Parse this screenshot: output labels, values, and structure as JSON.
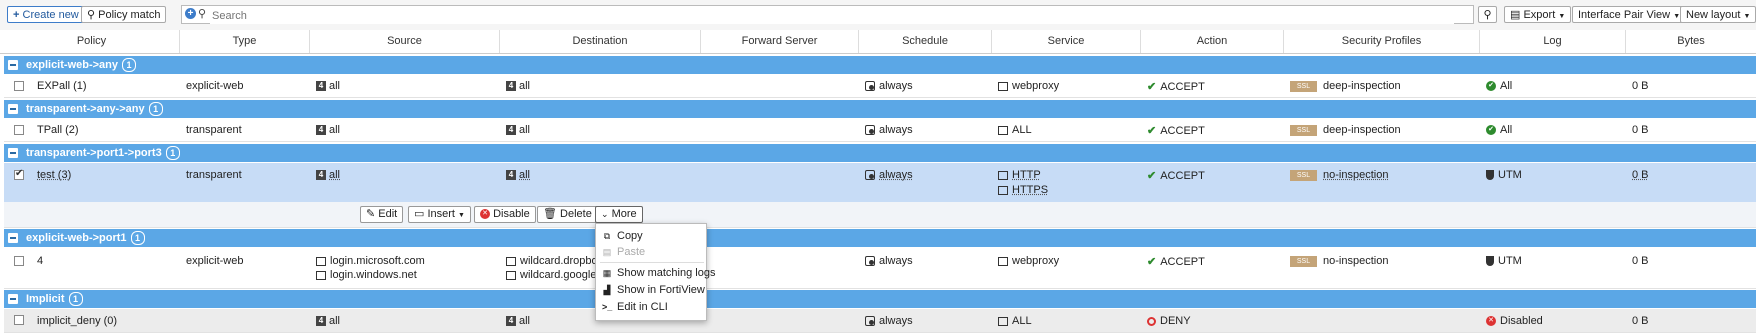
{
  "toolbar": {
    "create_new": "Create new",
    "policy_match": "Policy match",
    "search_placeholder": "Search",
    "export": "Export",
    "view": "Interface Pair View",
    "new_layout": "New layout"
  },
  "columns": [
    "Policy",
    "Type",
    "Source",
    "Destination",
    "Forward Server",
    "Schedule",
    "Service",
    "Action",
    "Security Profiles",
    "Log",
    "Bytes"
  ],
  "groups": [
    {
      "label": "explicit-web->any",
      "count": "1"
    },
    {
      "label": "transparent->any->any",
      "count": "1"
    },
    {
      "label": "transparent->port1->port3",
      "count": "1"
    },
    {
      "label": "explicit-web->port1",
      "count": "1"
    },
    {
      "label": "Implicit",
      "count": "1"
    }
  ],
  "rows": [
    {
      "policy": "EXPall (1)",
      "type": "explicit-web",
      "source": "all",
      "destination": "all",
      "schedule": "always",
      "service": "webproxy",
      "action": "ACCEPT",
      "ssl": "SSL",
      "profile": "deep-inspection",
      "log": "All",
      "bytes": "0 B"
    },
    {
      "policy": "TPall (2)",
      "type": "transparent",
      "source": "all",
      "destination": "all",
      "schedule": "always",
      "service": "ALL",
      "action": "ACCEPT",
      "ssl": "SSL",
      "profile": "deep-inspection",
      "log": "All",
      "bytes": "0 B"
    },
    {
      "policy": "test (3)",
      "type": "transparent",
      "source": "all",
      "destination": "all",
      "schedule": "always",
      "service": "HTTP",
      "service2": "HTTPS",
      "action": "ACCEPT",
      "ssl": "SSL",
      "profile": "no-inspection",
      "log": "UTM",
      "bytes": "0 B"
    },
    {
      "policy": "4",
      "type": "explicit-web",
      "source": "login.microsoft.com",
      "source2": "login.windows.net",
      "destination": "wildcard.dropbox",
      "destination2": "wildcard.google.c",
      "schedule": "always",
      "service": "webproxy",
      "action": "ACCEPT",
      "ssl": "SSL",
      "profile": "no-inspection",
      "log": "UTM",
      "bytes": "0 B"
    },
    {
      "policy": "implicit_deny (0)",
      "source": "all",
      "destination": "all",
      "schedule": "always",
      "service": "ALL",
      "action": "DENY",
      "log": "Disabled",
      "bytes": "0 B"
    }
  ],
  "actions": {
    "edit": "Edit",
    "insert": "Insert",
    "disable": "Disable",
    "delete": "Delete",
    "more": "More"
  },
  "menu": {
    "copy": "Copy",
    "paste": "Paste",
    "show_matching_logs": "Show matching logs",
    "show_in_fortiview": "Show in FortiView",
    "edit_in_cli": "Edit in CLI"
  }
}
